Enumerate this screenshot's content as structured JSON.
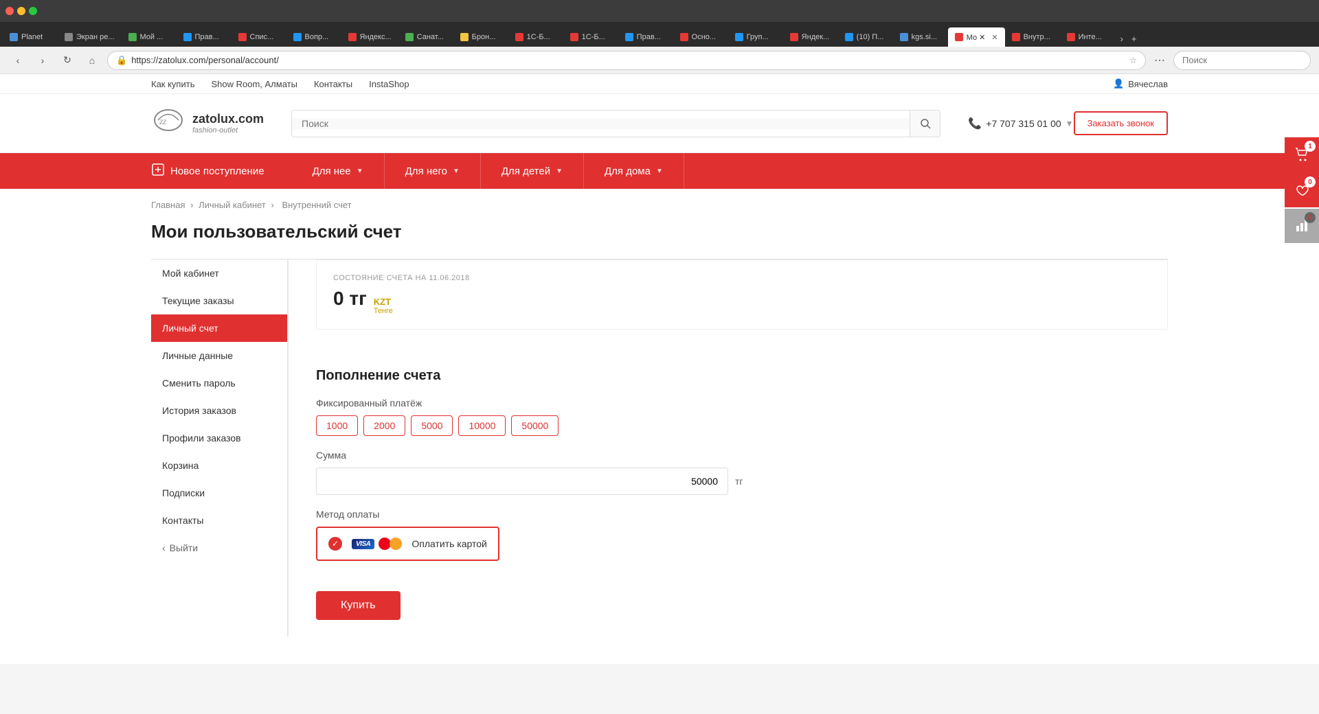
{
  "browser": {
    "tabs": [
      {
        "label": "Planet",
        "color": "#4a90d9",
        "active": false
      },
      {
        "label": "Экран ре...",
        "color": "#888",
        "active": false
      },
      {
        "label": "Мой ...",
        "color": "#4caf50",
        "active": false
      },
      {
        "label": "Прав...",
        "color": "#2196F3",
        "active": false
      },
      {
        "label": "Спис...",
        "color": "#e53935",
        "active": false
      },
      {
        "label": "Вопр...",
        "color": "#2196F3",
        "active": false
      },
      {
        "label": "Яндекс...",
        "color": "#e53935",
        "active": false
      },
      {
        "label": "Санат...",
        "color": "#4caf50",
        "active": false
      },
      {
        "label": "Брон...",
        "color": "#f4c542",
        "active": false
      },
      {
        "label": "1C-Б...",
        "color": "#e53935",
        "active": false
      },
      {
        "label": "1C-Б...",
        "color": "#e53935",
        "active": false
      },
      {
        "label": "Прав...",
        "color": "#2196F3",
        "active": false
      },
      {
        "label": "Осно...",
        "color": "#e53935",
        "active": false
      },
      {
        "label": "Груп...",
        "color": "#2196F3",
        "active": false
      },
      {
        "label": "Яндек...",
        "color": "#e53935",
        "active": false
      },
      {
        "label": "(10) П...",
        "color": "#2196F3",
        "active": false
      },
      {
        "label": "kgs.si...",
        "color": "#4a90d9",
        "active": false
      },
      {
        "label": "Мо ✕",
        "color": "#e53935",
        "active": true
      },
      {
        "label": "Внутр...",
        "color": "#e53935",
        "active": false
      },
      {
        "label": "Инте...",
        "color": "#e53935",
        "active": false
      }
    ],
    "url": "https://zatolux.com/personal/account/",
    "search_placeholder": "Поиск"
  },
  "topbar": {
    "links": [
      "Как купить",
      "Show Room, Алматы",
      "Контакты",
      "InstaShop"
    ],
    "user": "Вячеслав",
    "user_icon": "👤"
  },
  "header": {
    "logo_name": "zatolux.com",
    "logo_sub": "fashion-outlet",
    "search_placeholder": "Поиск",
    "phone": "+7 707 315 01 00",
    "cta_label": "Заказать звонок"
  },
  "nav": {
    "new_label": "Новое поступление",
    "items": [
      {
        "label": "Для нее"
      },
      {
        "label": "Для него"
      },
      {
        "label": "Для детей"
      },
      {
        "label": "Для дома"
      }
    ]
  },
  "breadcrumb": {
    "items": [
      "Главная",
      "Личный кабинет",
      "Внутренний счет"
    ]
  },
  "page": {
    "title": "Мои пользовательский счет"
  },
  "sidebar": {
    "items": [
      {
        "label": "Мой кабинет",
        "active": false
      },
      {
        "label": "Текущие заказы",
        "active": false
      },
      {
        "label": "Личный счет",
        "active": true
      },
      {
        "label": "Личные данные",
        "active": false
      },
      {
        "label": "Сменить пароль",
        "active": false
      },
      {
        "label": "История заказов",
        "active": false
      },
      {
        "label": "Профили заказов",
        "active": false
      },
      {
        "label": "Корзина",
        "active": false
      },
      {
        "label": "Подписки",
        "active": false
      },
      {
        "label": "Контакты",
        "active": false
      }
    ],
    "logout_label": "Выйти"
  },
  "account": {
    "balance_date_label": "СОСТОЯНИЕ СЧЕТА НА 11.06.2018",
    "balance_value": "0 тг",
    "balance_amount": "0",
    "balance_unit": "тг",
    "currency_code": "KZT",
    "currency_name": "Тенге"
  },
  "topup": {
    "title": "Пополнение счета",
    "fixed_label": "Фиксированный платёж",
    "amounts": [
      "1000",
      "2000",
      "5000",
      "10000",
      "50000"
    ],
    "sum_label": "Сумма",
    "sum_value": "50000",
    "sum_suffix": "тг",
    "payment_label": "Метод оплаты",
    "payment_option_label": "Оплатить картой",
    "buy_label": "Купить"
  },
  "float_sidebar": {
    "cart_count": "1",
    "wishlist_count": "0",
    "compare_count": "0"
  }
}
